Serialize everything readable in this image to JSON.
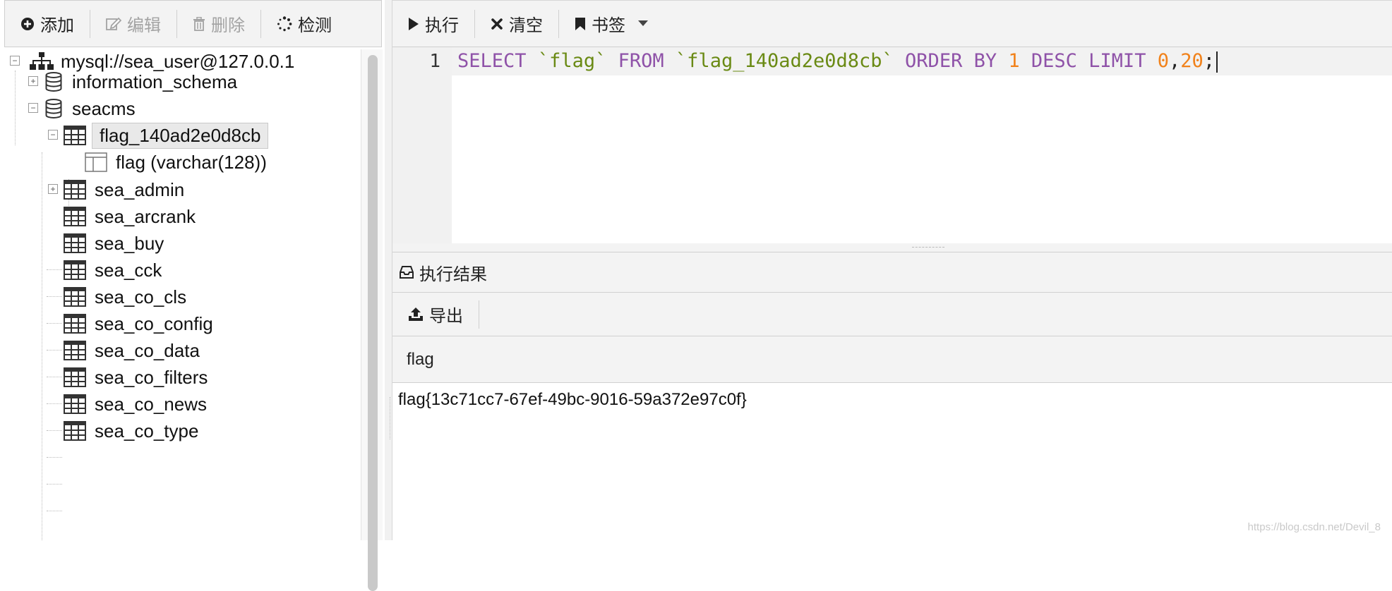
{
  "left_toolbar": {
    "add_label": "添加",
    "edit_label": "编辑",
    "delete_label": "删除",
    "check_label": "检测"
  },
  "tree": {
    "connection": "mysql://sea_user@127.0.0.1",
    "databases": [
      {
        "name": "information_schema",
        "expanded": false
      },
      {
        "name": "seacms",
        "expanded": true
      }
    ],
    "tables": [
      {
        "name": "flag_140ad2e0d8cb",
        "selected": true,
        "expanded": true
      },
      {
        "name": "sea_admin",
        "expanded": false
      },
      {
        "name": "sea_arcrank"
      },
      {
        "name": "sea_buy"
      },
      {
        "name": "sea_cck"
      },
      {
        "name": "sea_co_cls"
      },
      {
        "name": "sea_co_config"
      },
      {
        "name": "sea_co_data"
      },
      {
        "name": "sea_co_filters"
      },
      {
        "name": "sea_co_news"
      },
      {
        "name": "sea_co_type"
      }
    ],
    "column": "flag (varchar(128))"
  },
  "editor_toolbar": {
    "run_label": "执行",
    "clear_label": "清空",
    "bookmark_label": "书签"
  },
  "editor": {
    "line_number": "1",
    "tokens": {
      "t1": "SELECT",
      "t2": " ",
      "t3": "`flag`",
      "t4": " ",
      "t5": "FROM",
      "t6": " ",
      "t7": "`flag_140ad2e0d8cb`",
      "t8": " ",
      "t9": "ORDER BY",
      "t10": " ",
      "t11": "1",
      "t12": " ",
      "t13": "DESC LIMIT",
      "t14": " ",
      "t15": "0",
      "t16": ",",
      "t17": "20",
      "t18": ";"
    }
  },
  "results": {
    "header": "执行结果",
    "export_label": "导出",
    "columns": [
      "flag"
    ],
    "rows": [
      [
        "flag{13c71cc7-67ef-49bc-9016-59a372e97c0f}"
      ]
    ]
  },
  "watermark": "https://blog.csdn.net/Devil_8"
}
